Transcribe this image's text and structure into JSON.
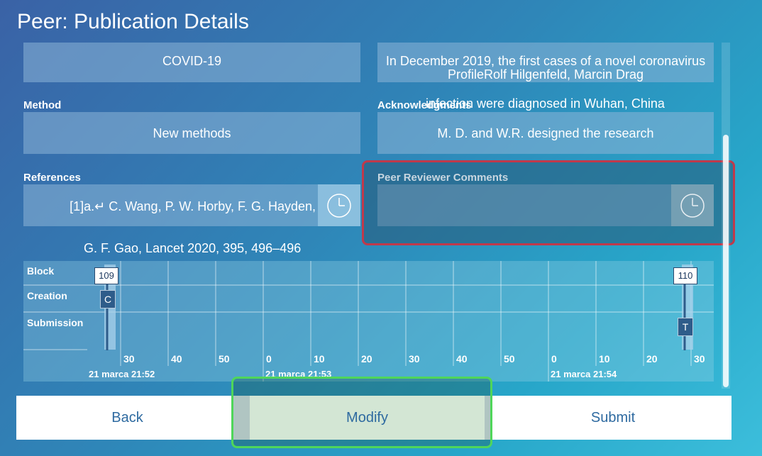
{
  "window": {
    "title": "Peer: Publication Details"
  },
  "fields": {
    "topic": "COVID-19",
    "abstract_line1": "In December 2019, the first cases of a novel coronavirus",
    "abstract_line2": "ProfileRolf Hilgenfeld, Marcin Drag",
    "abstract_line3": "infection were diagnosed in Wuhan, China",
    "method_label": "Method",
    "method_value": "New methods",
    "acknowledgments_label": "Acknowledgments",
    "acknowledgments_value": "M. D. and W.R. designed the research",
    "references_label": "References",
    "references_line1": "[1]a.↵ C. Wang, P. W. Horby, F. G. Hayden,",
    "references_line2": "G. F. Gao, Lancet 2020, 395, 496–496",
    "peer_comments_label": "Peer Reviewer Comments",
    "peer_comments_value": ""
  },
  "timeline": {
    "rows": [
      "Block",
      "Creation",
      "Submission"
    ],
    "ticks": [
      "30",
      "40",
      "50",
      "0",
      "10",
      "20",
      "30",
      "40",
      "50",
      "0",
      "10",
      "20",
      "30"
    ],
    "time_labels": [
      "21 marca 21:52",
      "21 marca 21:53",
      "21 marca 21:54"
    ],
    "block_markers": [
      "109",
      "110"
    ],
    "events": [
      "C",
      "T"
    ]
  },
  "buttons": {
    "back": "Back",
    "modify": "Modify",
    "submit": "Submit"
  },
  "colors": {
    "highlight_red": "#c0394b",
    "highlight_green": "#4fd65a",
    "modify_bg": "#d3e6d4",
    "button_text": "#2e6aa0"
  },
  "icons": {
    "clock": "clock-icon"
  }
}
